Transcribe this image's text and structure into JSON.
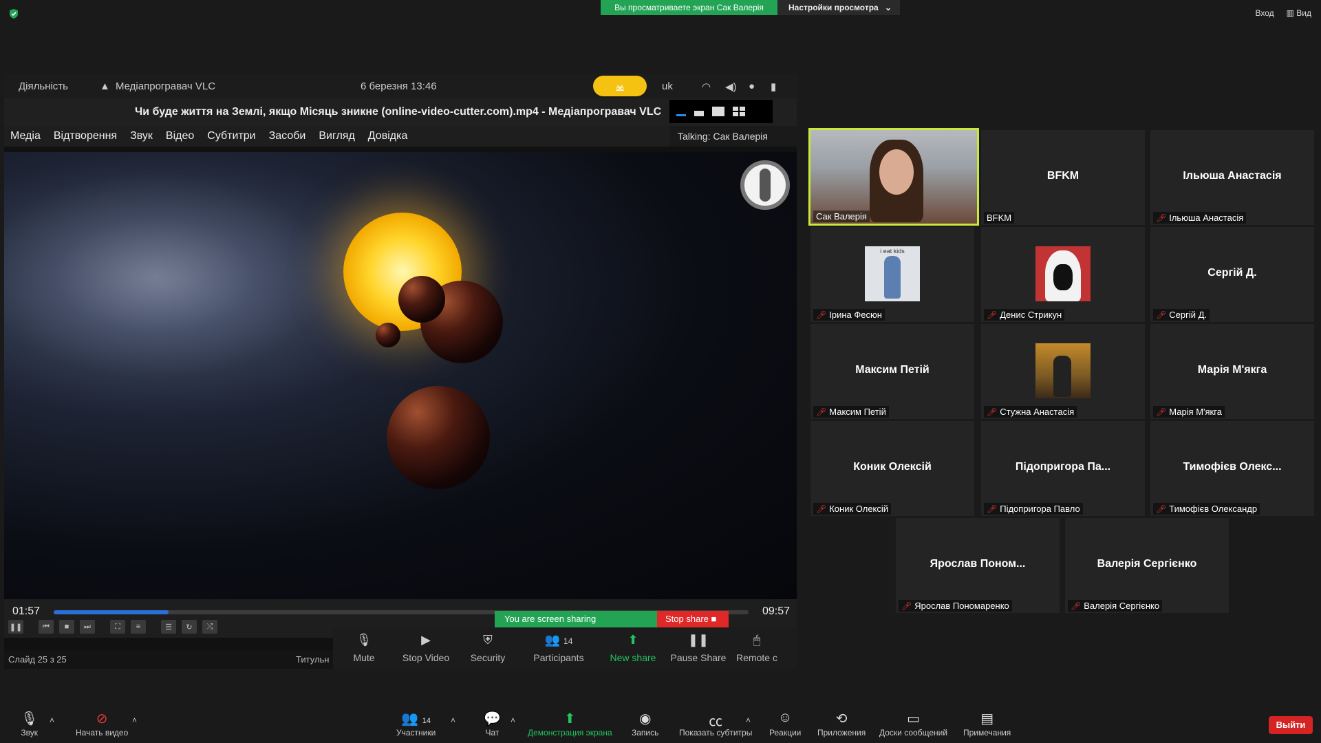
{
  "zoom_top": {
    "viewing_banner": "Вы просматриваете экран Сак Валерія",
    "view_options": "Настройки просмотра",
    "login": "Вход",
    "view": "Вид"
  },
  "shared_screen": {
    "gnome": {
      "activities": "Діяльність",
      "app_name": "Медіапрогравач VLC",
      "datetime": "6 березня  13:46",
      "language": "uk"
    },
    "vlc": {
      "window_title": "Чи буде життя на Землі, якщо Місяць зникне (online-video-cutter.com).mp4 - Медіапрогравач VLC",
      "menu": [
        "Медіа",
        "Відтворення",
        "Звук",
        "Відео",
        "Субтитри",
        "Засоби",
        "Вигляд",
        "Довідка"
      ],
      "time_elapsed": "01:57",
      "time_total": "09:57",
      "progress": 0.165
    },
    "talking": "Talking: Сак Валерія",
    "sharing": {
      "label": "You are screen sharing",
      "stop": "Stop share"
    },
    "zoom_tools": [
      {
        "label": "Mute",
        "icon": "microphone-icon"
      },
      {
        "label": "Stop Video",
        "icon": "video-camera-icon"
      },
      {
        "label": "Security",
        "icon": "shield-icon"
      },
      {
        "label": "Participants",
        "icon": "participants-icon",
        "count": "14"
      },
      {
        "label": "New share",
        "icon": "share-up-icon"
      },
      {
        "label": "Pause Share",
        "icon": "pause-icon"
      },
      {
        "label": "Remote c",
        "icon": "remote-control-icon"
      }
    ],
    "slide_status": "Слайд 25 з 25",
    "slide_title": "Титульн"
  },
  "participants": [
    {
      "name": "Сак Валерія",
      "center": "",
      "muted": false,
      "active": true,
      "video": true
    },
    {
      "name": "BFKM",
      "center": "BFKM",
      "muted": false
    },
    {
      "name": "Ільюша Анастасія",
      "center": "Ільюша Анастасія",
      "muted": true
    },
    {
      "name": "Ірина Фесюн",
      "center": "",
      "muted": true,
      "avatar": "i eat kids"
    },
    {
      "name": "Денис Стрикун",
      "center": "",
      "muted": true,
      "avatar": ""
    },
    {
      "name": "Сергій Д.",
      "center": "Сергій Д.",
      "muted": true
    },
    {
      "name": "Максим Петій",
      "center": "Максим Петій",
      "muted": true
    },
    {
      "name": "Стужна Анастасія",
      "center": "",
      "muted": true,
      "avatar": ""
    },
    {
      "name": "Марія М'якга",
      "center": "Марія М'якга",
      "muted": true
    },
    {
      "name": "Коник Олексій",
      "center": "Коник Олексій",
      "muted": true
    },
    {
      "name": "Підопригора Павло",
      "center": "Підопригора Па...",
      "muted": true
    },
    {
      "name": "Тимофієв Олександр",
      "center": "Тимофієв Олекс...",
      "muted": true
    },
    {
      "name": "Ярослав Пономаренко",
      "center": "Ярослав  Поном...",
      "muted": true
    },
    {
      "name": "Валерія Сергієнко",
      "center": "Валерія Сергієнко",
      "muted": true
    }
  ],
  "bottom_toolbar": {
    "audio": "Звук",
    "video": "Начать видео",
    "participants": "Участники",
    "participants_count": "14",
    "chat": "Чат",
    "share": "Демонстрация экрана",
    "record": "Запись",
    "captions": "Показать субтитры",
    "reactions": "Реакции",
    "apps": "Приложения",
    "boards": "Доски сообщений",
    "notes": "Примечания",
    "leave": "Выйти"
  },
  "colors": {
    "accent_green": "#23a455",
    "stop_red": "#e02828",
    "active_border": "#c9e83c"
  }
}
